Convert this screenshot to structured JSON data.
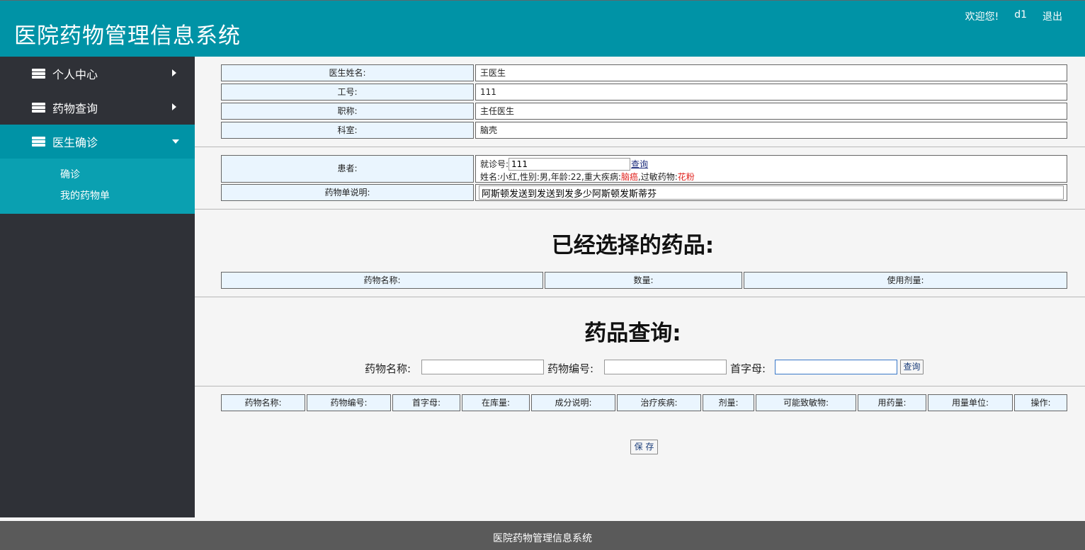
{
  "header": {
    "title": "医院药物管理信息系统",
    "welcome": "欢迎您!",
    "user": "d1",
    "logout": "退出"
  },
  "sidebar": {
    "items": [
      {
        "label": "个人中心"
      },
      {
        "label": "药物查询"
      },
      {
        "label": "医生确诊"
      }
    ],
    "submenu": [
      {
        "label": "确诊"
      },
      {
        "label": "我的药物单"
      }
    ]
  },
  "doctor": {
    "name_label": "医生姓名:",
    "name": "王医生",
    "id_label": "工号:",
    "id": "111",
    "title_label": "职称:",
    "title": "主任医生",
    "dept_label": "科室:",
    "dept": "脑壳"
  },
  "patient": {
    "label": "患者:",
    "visit_label": "就诊号:",
    "visit_value": "111",
    "query_link": "查询",
    "info_prefix": "姓名:小红,性别:男,年龄:22,重大疾病:",
    "disease": "脑癌",
    "allergy_prefix": ",过敏药物:",
    "allergy": "花粉",
    "note_label": "药物单说明:",
    "note_value": "阿斯顿发送到发送到发多少阿斯顿发斯蒂芬"
  },
  "selected": {
    "title": "已经选择的药品:",
    "columns": [
      "药物名称:",
      "数量:",
      "使用剂量:"
    ]
  },
  "query": {
    "title": "药品查询:",
    "name_label": "药物名称:",
    "code_label": "药物编号:",
    "initial_label": "首字母:",
    "button": "查询",
    "columns": [
      "药物名称:",
      "药物编号:",
      "首字母:",
      "在库量:",
      "成分说明:",
      "治疗疾病:",
      "剂量:",
      "可能致敏物:",
      "用药量:",
      "用量单位:",
      "操作:"
    ]
  },
  "save_button": "保 存",
  "footer": "医院药物管理信息系统"
}
